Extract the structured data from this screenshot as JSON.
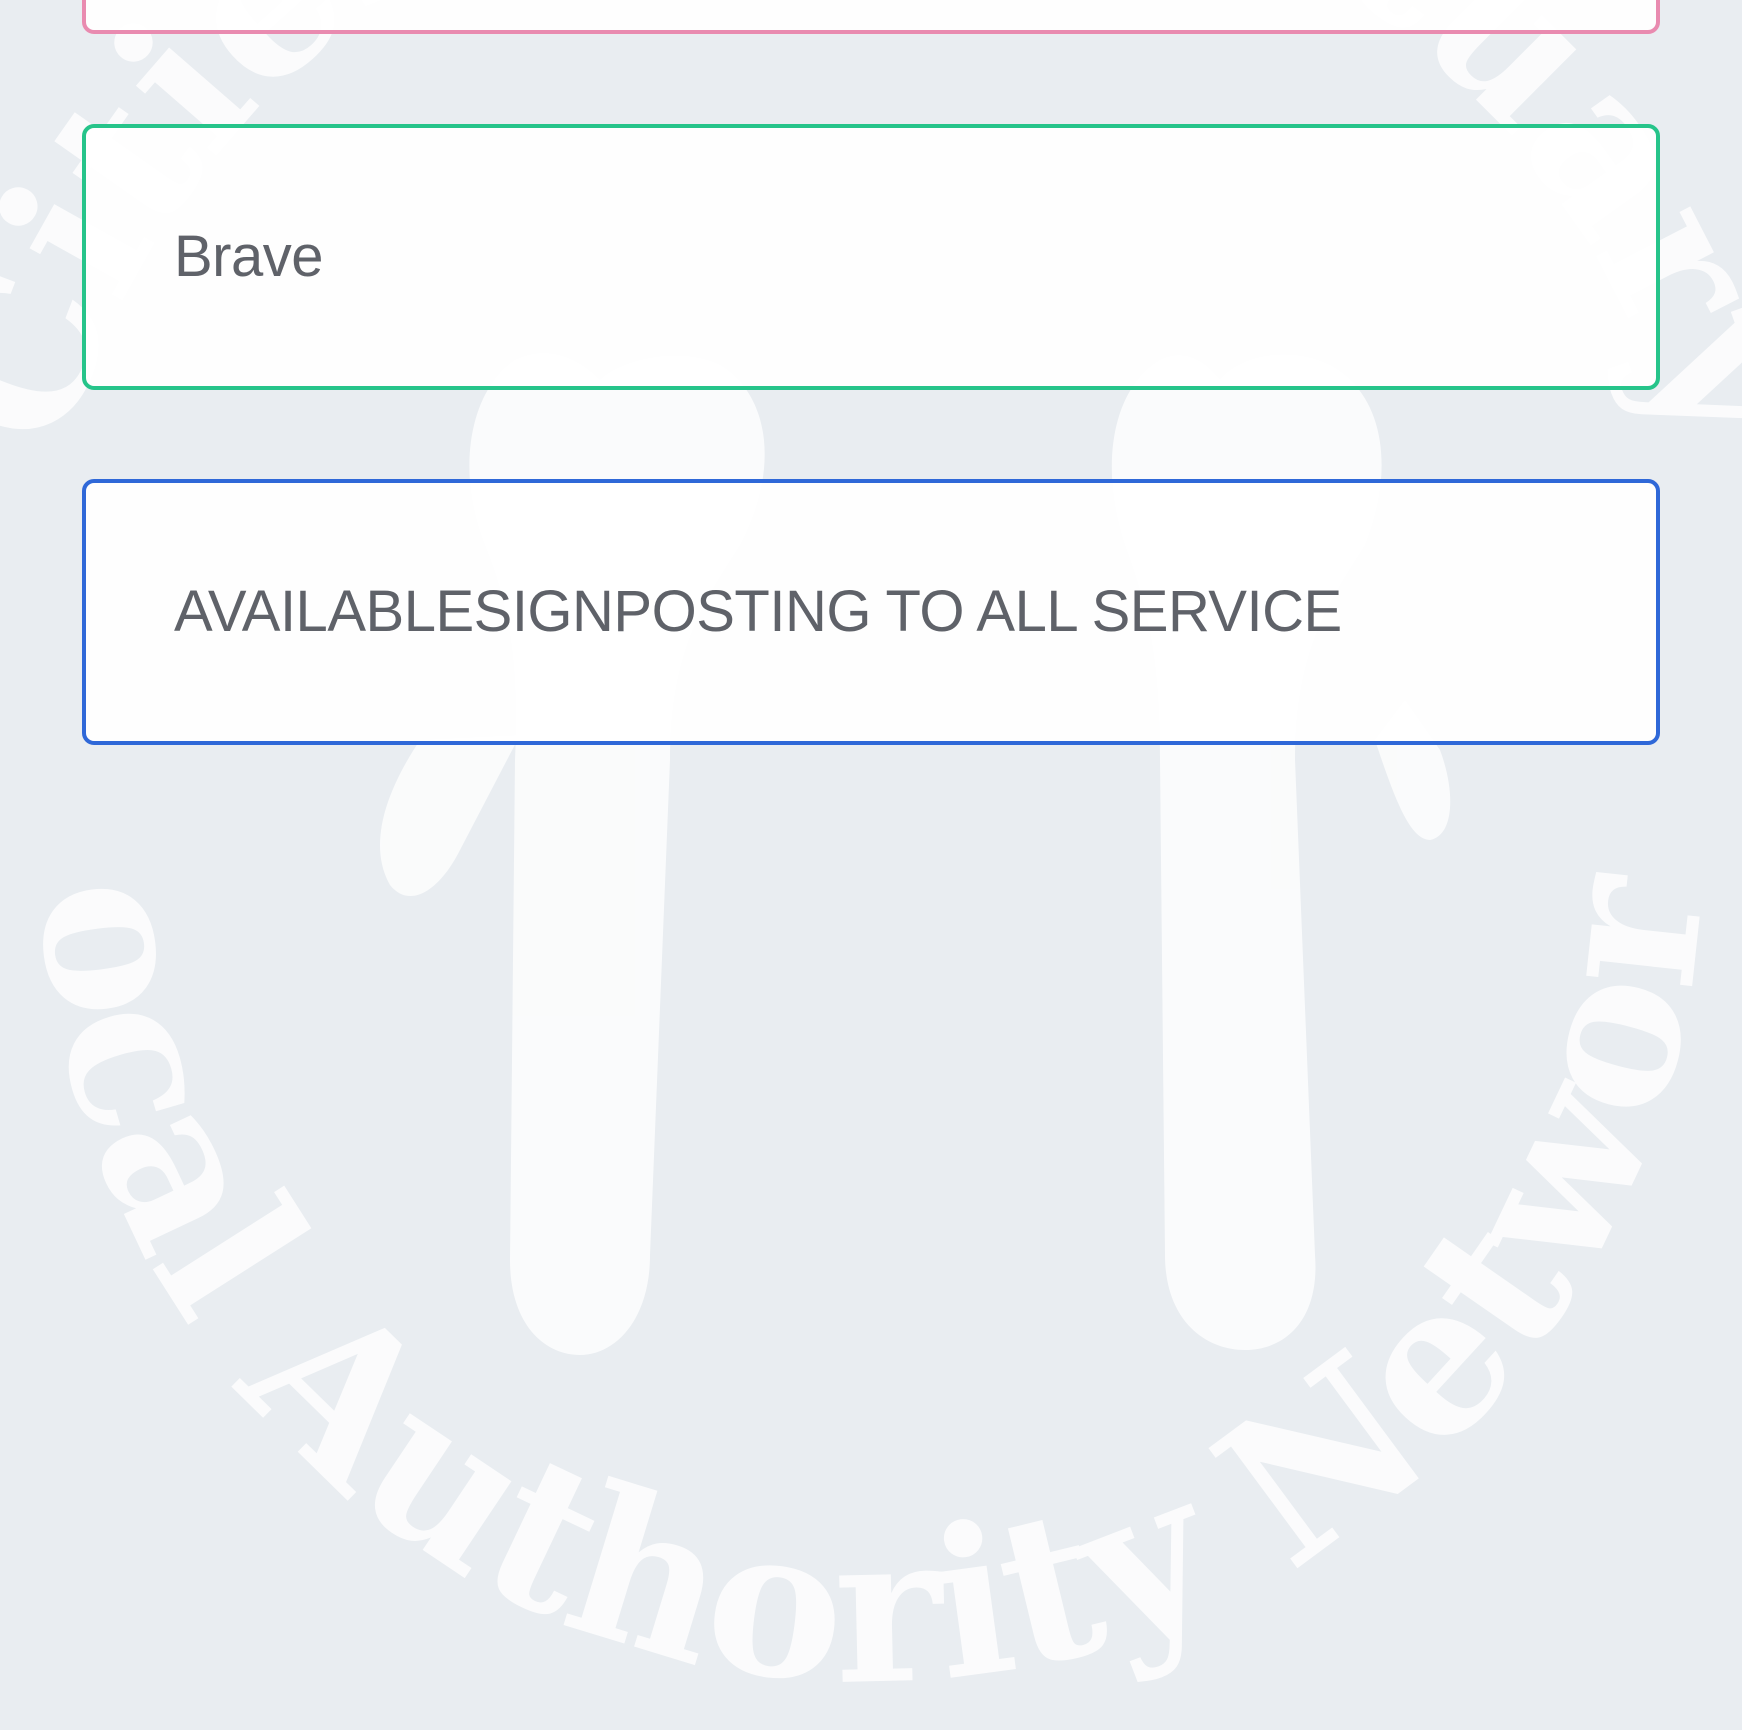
{
  "background": {
    "watermark_text_top": "Cities of Sanctuary",
    "watermark_text_bottom": "Local Authority Network",
    "watermark_color": "#ffffff",
    "page_color": "#e9edf1"
  },
  "cards": [
    {
      "label": "",
      "border_color": "#e98bb0"
    },
    {
      "label": "Brave",
      "border_color": "#26c48a"
    },
    {
      "label": "AVAILABLESIGNPOSTING TO ALL SERVICE",
      "border_color": "#2f68d8"
    }
  ]
}
